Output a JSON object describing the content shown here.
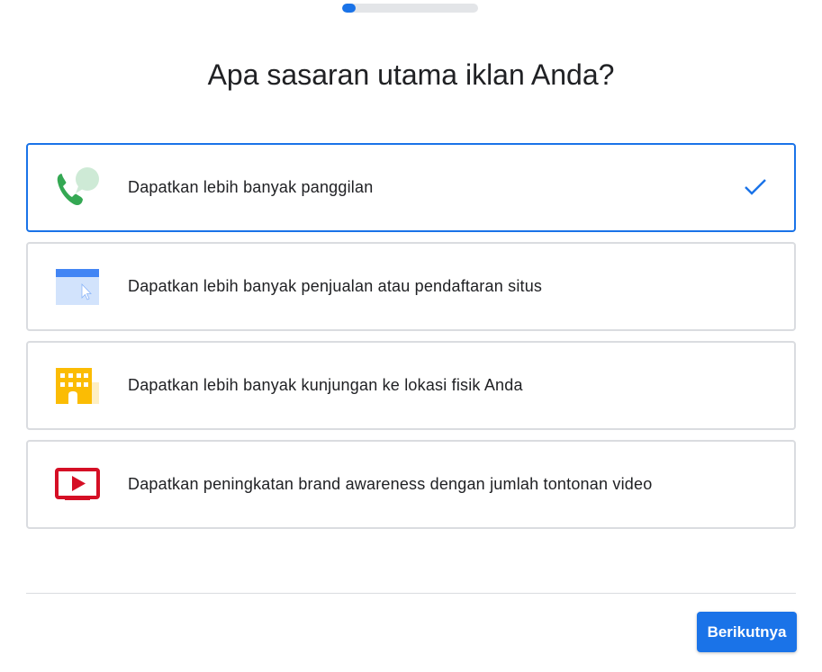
{
  "progress": {
    "fraction": 0.1
  },
  "page_title": "Apa sasaran utama iklan Anda?",
  "options": [
    {
      "label": "Dapatkan lebih banyak panggilan",
      "icon": "phone-chat-icon",
      "selected": true
    },
    {
      "label": "Dapatkan lebih banyak penjualan atau pendaftaran situs",
      "icon": "website-click-icon",
      "selected": false
    },
    {
      "label": "Dapatkan lebih banyak kunjungan ke lokasi fisik Anda",
      "icon": "storefront-building-icon",
      "selected": false
    },
    {
      "label": "Dapatkan peningkatan brand awareness dengan jumlah tontonan video",
      "icon": "video-play-icon",
      "selected": false
    }
  ],
  "footer": {
    "next_label": "Berikutnya"
  },
  "colors": {
    "accent": "#1a73e8",
    "border": "#dadce0",
    "phone_green": "#34a853",
    "building_yellow": "#fbbc04",
    "video_red": "#d50f25"
  }
}
